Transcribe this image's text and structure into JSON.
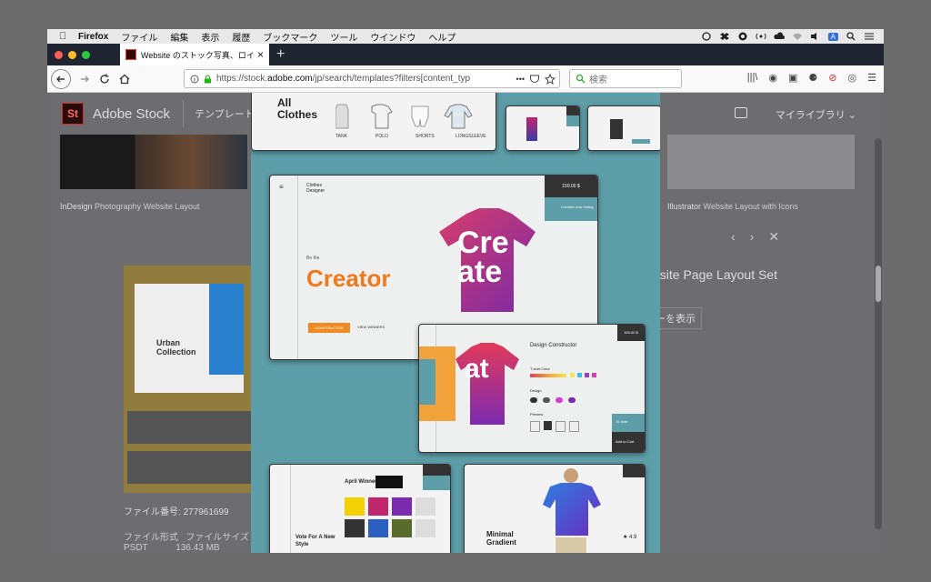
{
  "menubar": {
    "app": "Firefox",
    "items": [
      "ファイル",
      "編集",
      "表示",
      "履歴",
      "ブックマーク",
      "ツール",
      "ウインドウ",
      "ヘルプ"
    ],
    "status_letter": "A"
  },
  "tab": {
    "title": "Website のストック写真、ロイヤ",
    "close": "×",
    "new_tab": "+"
  },
  "nav": {
    "url_prefix": "https://stock.",
    "url_domain": "adobe.com",
    "url_rest": "/jp/search/templates?filters[content_typ",
    "dots": "•••",
    "search_placeholder": "検索"
  },
  "stock": {
    "logo": "St",
    "name": "Adobe Stock",
    "template_menu": "テンプレート",
    "my_library": "マイライブラリ ⌄",
    "left_label_app": "InDesign",
    "left_label_title": "Photography Website Layout",
    "right_label_app": "Illustrator",
    "right_label_title": "Website Layout with Icons",
    "page_title": "osite Page Layout Set",
    "show_button": "ーを表示",
    "file_number_label": "ファイル番号:",
    "file_number": "277961699",
    "file_format_label": "ファイル形式",
    "file_size_label": "ファイルサイズ",
    "file_format": "PSDT",
    "file_size": "136.43 MB"
  },
  "lightbox": {
    "card1_title": "All Clothes",
    "card1_items": [
      "TANK",
      "POLO",
      "SHORTS",
      "LONGSLEEVE"
    ],
    "main_header": "Clothes Designer",
    "main_price": "159.00 $",
    "main_kicker": "Be the",
    "main_headline": "Creator",
    "main_cta": "CONSTRUCTOR",
    "main_link": "VIEW WINNERS",
    "main_voting": "Creative now Voting",
    "shirt_text_1": "Cre",
    "shirt_text_2": "ate",
    "constructor_title": "Design Constructor",
    "constructor_price": "159.00 $",
    "constructor_color": "T-shirt Color",
    "constructor_design": "Design",
    "constructor_preview": "Preview",
    "constructor_vote": "To Vote",
    "constructor_cart": "Add to Cart",
    "constructor_shirt_text": "at",
    "card4_title": "April Winner",
    "card4_vote": "Vote For A New Style",
    "card5_title": "Minimal Gradient",
    "card5_rating": "★ 4.9",
    "urban": "Urban Collection"
  }
}
